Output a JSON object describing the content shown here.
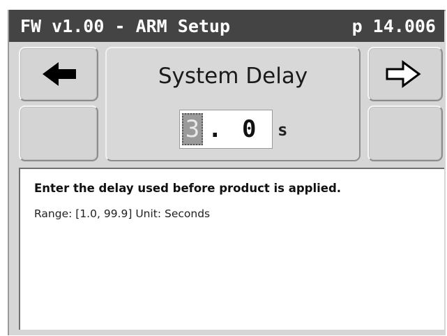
{
  "header": {
    "title": "FW v1.00 - ARM Setup",
    "page": "p 14.006"
  },
  "navigation": {
    "back_icon": "left-arrow-icon",
    "forward_icon": "right-arrow-icon"
  },
  "parameter": {
    "name": "System Delay",
    "value_selected_digit": "3",
    "value_rest": ". 0",
    "unit": "s"
  },
  "help": {
    "description": "Enter the delay used before product is applied.",
    "range": "Range: [1.0, 99.9]  Unit: Seconds"
  },
  "colors": {
    "titlebar": "#444444",
    "panel": "#d6d6d6",
    "selected_digit_bg": "#9a9a9a"
  }
}
